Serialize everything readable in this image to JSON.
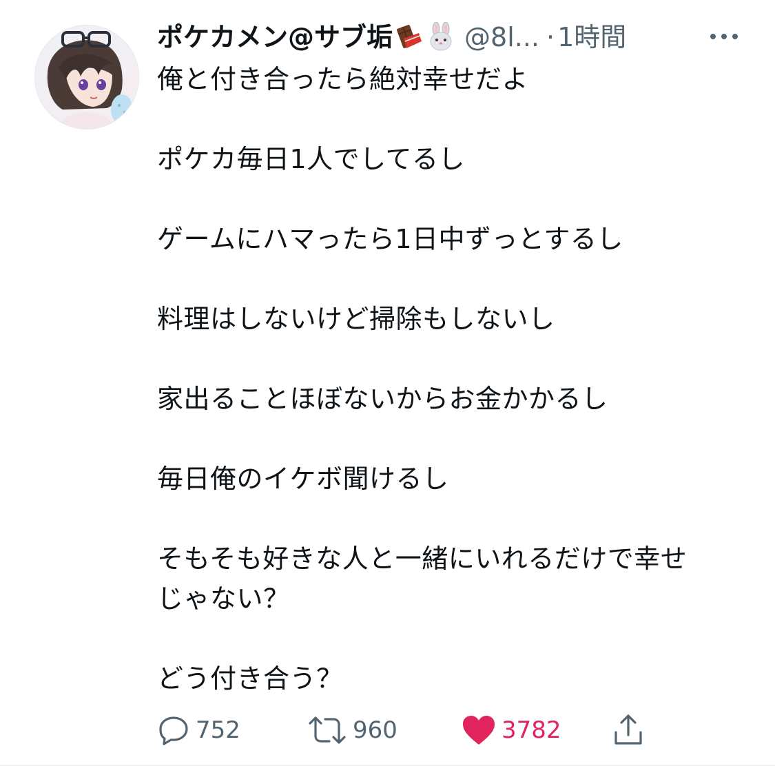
{
  "tweet": {
    "display_name": "ポケカメン@サブ垢",
    "emoji_icons": [
      "chocolate-bar-icon",
      "rabbit-face-icon"
    ],
    "handle": "@8l...",
    "separator": "·",
    "time": "1時間",
    "body_lines": [
      "俺と付き合ったら絶対幸せだよ",
      "",
      "ポケカ毎日1人でしてるし",
      "",
      "ゲームにハマったら1日中ずっとするし",
      "",
      "料理はしないけど掃除もしないし",
      "",
      "家出ることほぼないからお金かかるし",
      "",
      "毎日俺のイケボ聞けるし",
      "",
      "そもそも好きな人と一緒にいれるだけで幸せ",
      "じゃない？",
      "",
      "どう付き合う？"
    ],
    "actions": {
      "reply_count": "752",
      "retweet_count": "960",
      "like_count": "3782"
    }
  },
  "colors": {
    "text": "#0f1419",
    "secondary": "#536471",
    "like": "#e0245e",
    "divider": "#eff3f4"
  }
}
